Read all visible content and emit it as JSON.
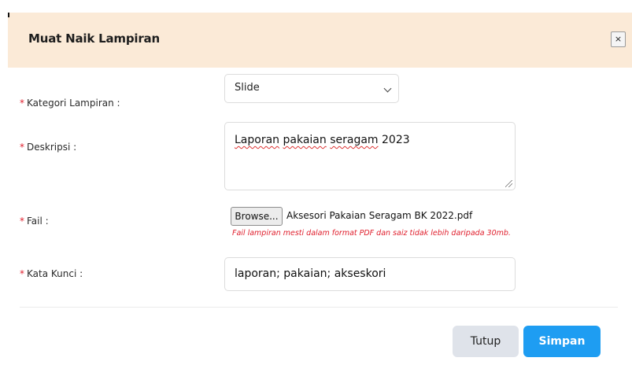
{
  "modal": {
    "title": "Muat Naik Lampiran",
    "close_symbol": "×"
  },
  "form": {
    "category": {
      "required_mark": "*",
      "label": "Kategori Lampiran :",
      "selected": "Slide",
      "icon": "chevron-down-icon"
    },
    "description": {
      "required_mark": "*",
      "label": "Deskripsi :",
      "value_word1": "Laporan",
      "value_word2": "pakaian",
      "value_word3": "seragam",
      "value_word4": "2023"
    },
    "file": {
      "required_mark": "*",
      "label": "Fail :",
      "browse_label": "Browse...",
      "file_name": "Aksesori Pakaian Seragam BK 2022.pdf",
      "hint": "Fail lampiran mesti dalam format PDF dan saiz tidak lebih daripada 30mb."
    },
    "keywords": {
      "required_mark": "*",
      "label": "Kata Kunci :",
      "value": "laporan; pakaian; akseskori"
    }
  },
  "footer": {
    "close_label": "Tutup",
    "save_label": "Simpan"
  },
  "colors": {
    "header_bg": "#fbead7",
    "required": "#e0202e",
    "primary": "#1e9df2",
    "secondary": "#dfe3ea"
  }
}
